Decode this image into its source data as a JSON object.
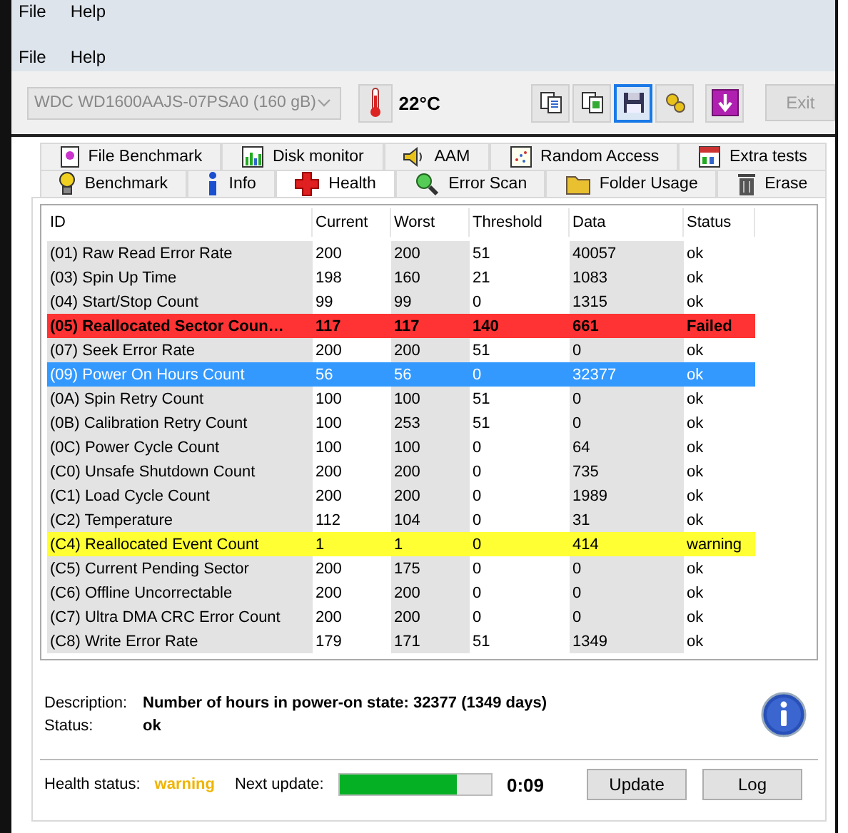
{
  "menus": [
    {
      "items": [
        "File",
        "Help"
      ]
    },
    {
      "items": [
        "File",
        "Help"
      ]
    }
  ],
  "toolbar": {
    "drive": {
      "value": "WDC WD1600AAJS-07PSA0 (160 gB)",
      "disabled": true
    },
    "temperature": "22°C",
    "buttons": [
      {
        "focused": false
      },
      {
        "focused": false
      },
      {
        "focused": true
      },
      {
        "focused": false
      },
      {
        "focused": false
      }
    ],
    "exit": {
      "label": "Exit",
      "disabled": true
    }
  },
  "tabs_back": [
    {
      "label": "File Benchmark",
      "selected": false
    },
    {
      "label": "Disk monitor",
      "selected": false
    },
    {
      "label": "AAM",
      "selected": false
    },
    {
      "label": "Random Access",
      "selected": false
    },
    {
      "label": "Extra tests",
      "selected": false
    }
  ],
  "tabs_front": [
    {
      "label": "Benchmark",
      "selected": false
    },
    {
      "label": "Info",
      "selected": false
    },
    {
      "label": "Health",
      "selected": true
    },
    {
      "label": "Error Scan",
      "selected": false
    },
    {
      "label": "Folder Usage",
      "selected": false
    },
    {
      "label": "Erase",
      "selected": false
    }
  ],
  "table": {
    "columns": [
      "ID",
      "Current",
      "Worst",
      "Threshold",
      "Data",
      "Status"
    ],
    "rows": [
      {
        "kind": "normal",
        "selected": false,
        "cells": [
          "(01) Raw Read Error Rate",
          "200",
          "200",
          "51",
          "40057",
          "ok"
        ]
      },
      {
        "kind": "normal",
        "selected": false,
        "cells": [
          "(03) Spin Up Time",
          "198",
          "160",
          "21",
          "1083",
          "ok"
        ]
      },
      {
        "kind": "normal",
        "selected": false,
        "cells": [
          "(04) Start/Stop Count",
          "99",
          "99",
          "0",
          "1315",
          "ok"
        ]
      },
      {
        "kind": "failed",
        "selected": false,
        "cells": [
          "(05) Reallocated Sector Coun…",
          "117",
          "117",
          "140",
          "661",
          "Failed"
        ]
      },
      {
        "kind": "normal",
        "selected": false,
        "cells": [
          "(07) Seek Error Rate",
          "200",
          "200",
          "51",
          "0",
          "ok"
        ]
      },
      {
        "kind": "normal",
        "selected": true,
        "cells": [
          "(09) Power On Hours Count",
          "56",
          "56",
          "0",
          "32377",
          "ok"
        ]
      },
      {
        "kind": "normal",
        "selected": false,
        "cells": [
          "(0A) Spin Retry Count",
          "100",
          "100",
          "51",
          "0",
          "ok"
        ]
      },
      {
        "kind": "normal",
        "selected": false,
        "cells": [
          "(0B) Calibration Retry Count",
          "100",
          "253",
          "51",
          "0",
          "ok"
        ]
      },
      {
        "kind": "normal",
        "selected": false,
        "cells": [
          "(0C) Power Cycle Count",
          "100",
          "100",
          "0",
          "64",
          "ok"
        ]
      },
      {
        "kind": "normal",
        "selected": false,
        "cells": [
          "(C0) Unsafe Shutdown Count",
          "200",
          "200",
          "0",
          "735",
          "ok"
        ]
      },
      {
        "kind": "normal",
        "selected": false,
        "cells": [
          "(C1) Load Cycle Count",
          "200",
          "200",
          "0",
          "1989",
          "ok"
        ]
      },
      {
        "kind": "normal",
        "selected": false,
        "cells": [
          "(C2) Temperature",
          "112",
          "104",
          "0",
          "31",
          "ok"
        ]
      },
      {
        "kind": "warning",
        "selected": false,
        "cells": [
          "(C4) Reallocated Event Count",
          "1",
          "1",
          "0",
          "414",
          "warning"
        ]
      },
      {
        "kind": "normal",
        "selected": false,
        "cells": [
          "(C5) Current Pending Sector",
          "200",
          "175",
          "0",
          "0",
          "ok"
        ]
      },
      {
        "kind": "normal",
        "selected": false,
        "cells": [
          "(C6) Offline Uncorrectable",
          "200",
          "200",
          "0",
          "0",
          "ok"
        ]
      },
      {
        "kind": "normal",
        "selected": false,
        "cells": [
          "(C7) Ultra DMA CRC Error Count",
          "200",
          "200",
          "0",
          "0",
          "ok"
        ]
      },
      {
        "kind": "normal",
        "selected": false,
        "cells": [
          "(C8) Write Error Rate",
          "179",
          "171",
          "51",
          "1349",
          "ok"
        ]
      }
    ]
  },
  "details": {
    "description_label": "Description:",
    "description": "Number of hours in power-on state: 32377 (1349 days)",
    "status_label": "Status:",
    "status": "ok"
  },
  "footer": {
    "health_label": "Health status:",
    "health": "warning",
    "next_label": "Next update:",
    "level": 0.77,
    "countdown": "0:09",
    "buttons": [
      "Update",
      "Log"
    ]
  }
}
